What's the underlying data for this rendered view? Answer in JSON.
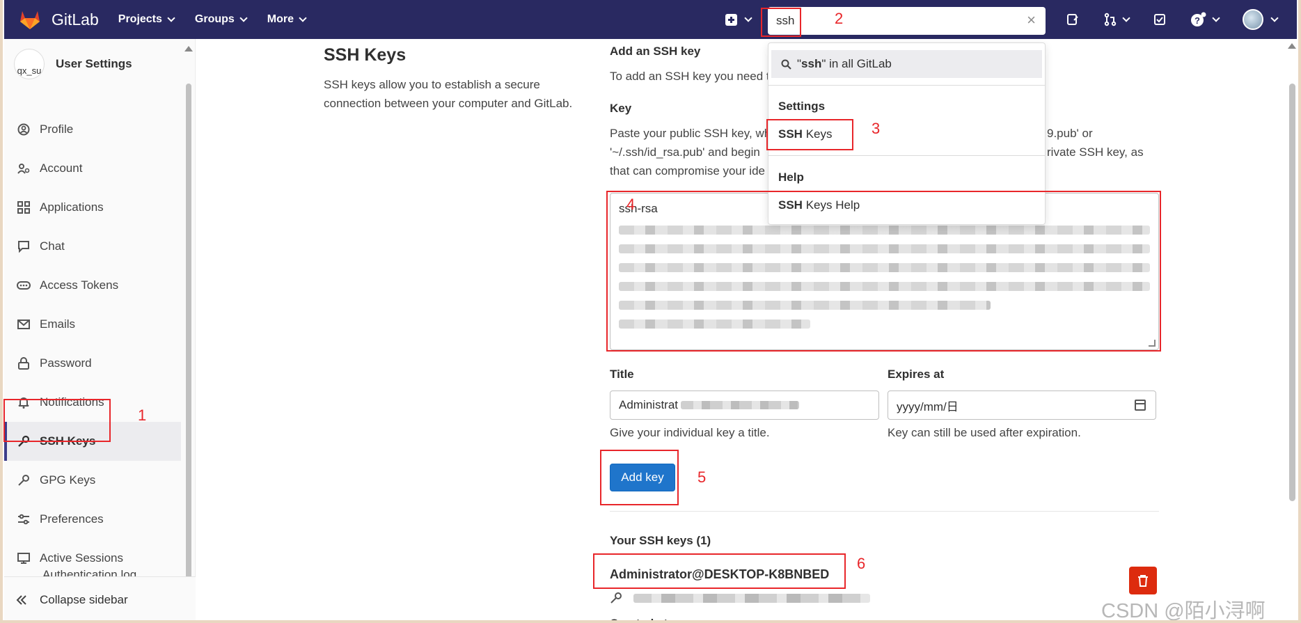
{
  "navbar": {
    "brand": "GitLab",
    "menu": [
      {
        "label": "Projects"
      },
      {
        "label": "Groups"
      },
      {
        "label": "More"
      }
    ],
    "search_value": "ssh",
    "clear_glyph": "×",
    "colors": {
      "navbar_bg": "#292961",
      "accent": "#1f75cb"
    }
  },
  "search_dropdown": {
    "scope_prefix": "\"",
    "scope_term": "ssh",
    "scope_suffix": "\" in all GitLab",
    "settings_heading": "Settings",
    "settings_result_bold": "SSH",
    "settings_result_rest": " Keys",
    "help_heading": "Help",
    "help_result_bold": "SSH",
    "help_result_rest": " Keys Help"
  },
  "sidebar": {
    "avatar_text": "qx_su",
    "title": "User Settings",
    "items": [
      {
        "label": "Profile",
        "icon": "profile-icon"
      },
      {
        "label": "Account",
        "icon": "account-icon"
      },
      {
        "label": "Applications",
        "icon": "applications-icon"
      },
      {
        "label": "Chat",
        "icon": "chat-icon"
      },
      {
        "label": "Access Tokens",
        "icon": "token-icon"
      },
      {
        "label": "Emails",
        "icon": "mail-icon"
      },
      {
        "label": "Password",
        "icon": "lock-icon"
      },
      {
        "label": "Notifications",
        "icon": "bell-icon"
      },
      {
        "label": "SSH Keys",
        "icon": "key-icon",
        "active": true
      },
      {
        "label": "GPG Keys",
        "icon": "key-icon"
      },
      {
        "label": "Preferences",
        "icon": "preferences-icon"
      },
      {
        "label": "Active Sessions",
        "icon": "monitor-icon"
      }
    ],
    "partial_item": "Authentication log",
    "collapse_label": "Collapse sidebar"
  },
  "page": {
    "title": "SSH Keys",
    "description": "SSH keys allow you to establish a secure connection between your computer and GitLab.",
    "add_heading": "Add an SSH key",
    "add_intro": "To add an SSH key you need t",
    "key_label": "Key",
    "key_help_line1": "Paste your public SSH key, wh",
    "key_help_line1_end": "9.pub' or",
    "key_help_line2": "'~/.ssh/id_rsa.pub' and begin",
    "key_help_line2_end": "rivate SSH key, as",
    "key_help_line3": "that can compromise your ide",
    "key_value_first": "ssh-rsa",
    "title_label": "Title",
    "title_value": "Administrat",
    "title_help": "Give your individual key a title.",
    "expires_label": "Expires at",
    "expires_placeholder": "yyyy/mm/日",
    "expires_help": "Key can still be used after expiration.",
    "add_button": "Add key",
    "your_keys_heading": "Your SSH keys (1)",
    "key_title": "Administrator@DESKTOP-K8BNBED"
  },
  "annotations": [
    "1",
    "2",
    "3",
    "4",
    "5",
    "6"
  ],
  "watermark": "CSDN @陌小浔啊"
}
